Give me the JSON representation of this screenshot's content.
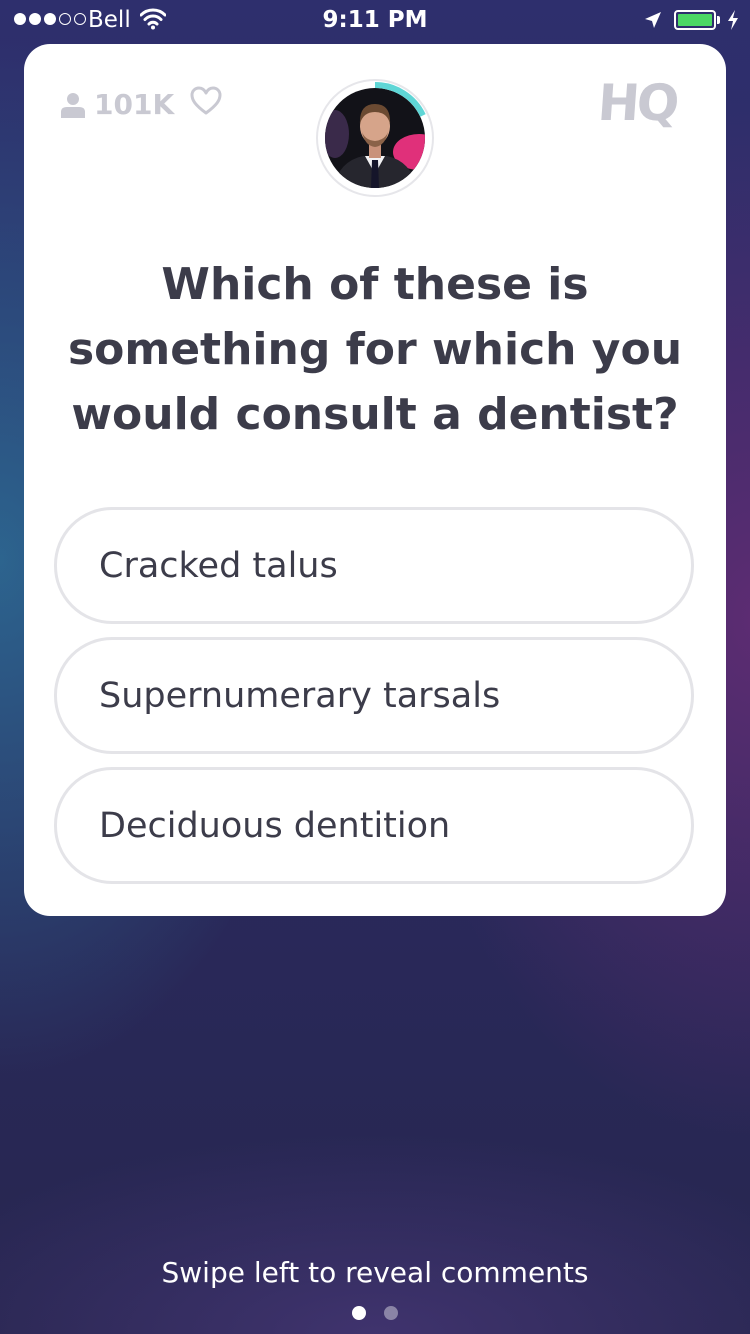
{
  "status_bar": {
    "carrier": "Bell",
    "time": "9:11 PM",
    "signal_bars_full": 3,
    "signal_bars_total": 5,
    "battery_level": 1.0,
    "battery_color": "#4cd964",
    "icons": [
      "wifi-icon",
      "location-arrow-icon",
      "battery-icon",
      "charging-bolt-icon"
    ]
  },
  "header": {
    "viewer_count": "101K",
    "viewer_icon": "person-icon",
    "like_icon": "heart-icon",
    "logo_text": "HQ",
    "host_timer_progress": 0.18,
    "timer_color": "#5fd6d6"
  },
  "question": {
    "text": "Which of these is something for which you would consult a dentist?"
  },
  "answers": [
    {
      "label": "Cracked talus"
    },
    {
      "label": "Supernumerary tarsals"
    },
    {
      "label": "Deciduous dentition"
    }
  ],
  "footer": {
    "hint": "Swipe left to reveal comments",
    "page_count": 2,
    "active_page": 1
  },
  "colors": {
    "card_background": "#ffffff",
    "text_primary": "#3c3c4a",
    "muted_gray": "#c9c9d2",
    "answer_border": "#e4e4e8"
  }
}
